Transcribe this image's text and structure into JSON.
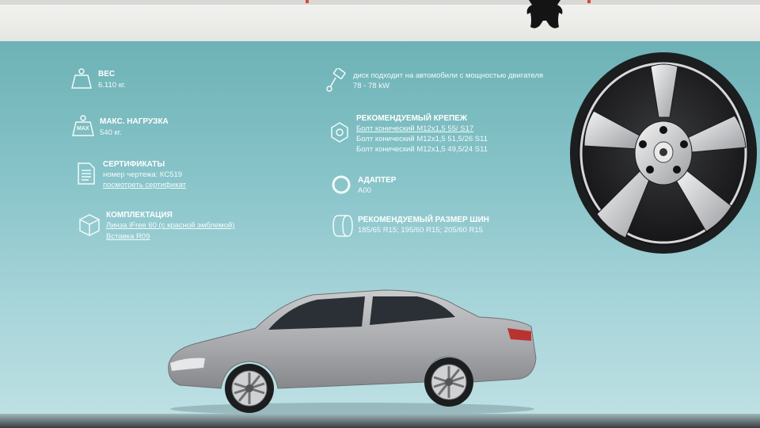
{
  "specs_left": {
    "weight": {
      "title": "ВЕС",
      "value": "6.110 кг."
    },
    "max_load": {
      "title": "МАКС. НАГРУЗКА",
      "value": "540 кг.",
      "icon_text": "MAX"
    },
    "certificates": {
      "title": "СЕРТИФИКАТЫ",
      "drawing_number": "номер чертежа: КС519",
      "certificate_link": "посмотреть сертификат"
    },
    "package": {
      "title": "КОМПЛЕКТАЦИЯ",
      "item1": "Линза iFree 60 (с красной эмблемой)",
      "item2": "Вставка R09"
    }
  },
  "specs_right": {
    "engine": {
      "text": "диск подходит на автомобили с мощностью двигателя",
      "value": "78 - 78 kW"
    },
    "fasteners": {
      "title": "РЕКОМЕНДУЕМЫЙ КРЕПЕЖ",
      "items": [
        "Болт конический M12x1,5 55/ S17",
        "Болт конический M12x1,5 51,5/26 S11",
        "Болт конический M12x1,5 49,5/24 S11"
      ]
    },
    "adapter": {
      "title": "АДАПТЕР",
      "value": "А00"
    },
    "tire_size": {
      "title": "РЕКОМЕНДУЕМЫЙ РАЗМЕР ШИН",
      "value": "185/65 R15; 195/60 R15; 205/60 R15"
    }
  },
  "colors": {
    "panel": "#86c3c8",
    "text": "#ffffff",
    "car_body": "#a7a9ac",
    "wheel_dark": "#2a2b2d"
  },
  "icons": [
    "weight-icon",
    "max-load-icon",
    "document-icon",
    "box-icon",
    "piston-icon",
    "bolt-nut-icon",
    "adapter-ring-icon",
    "tire-icon"
  ]
}
